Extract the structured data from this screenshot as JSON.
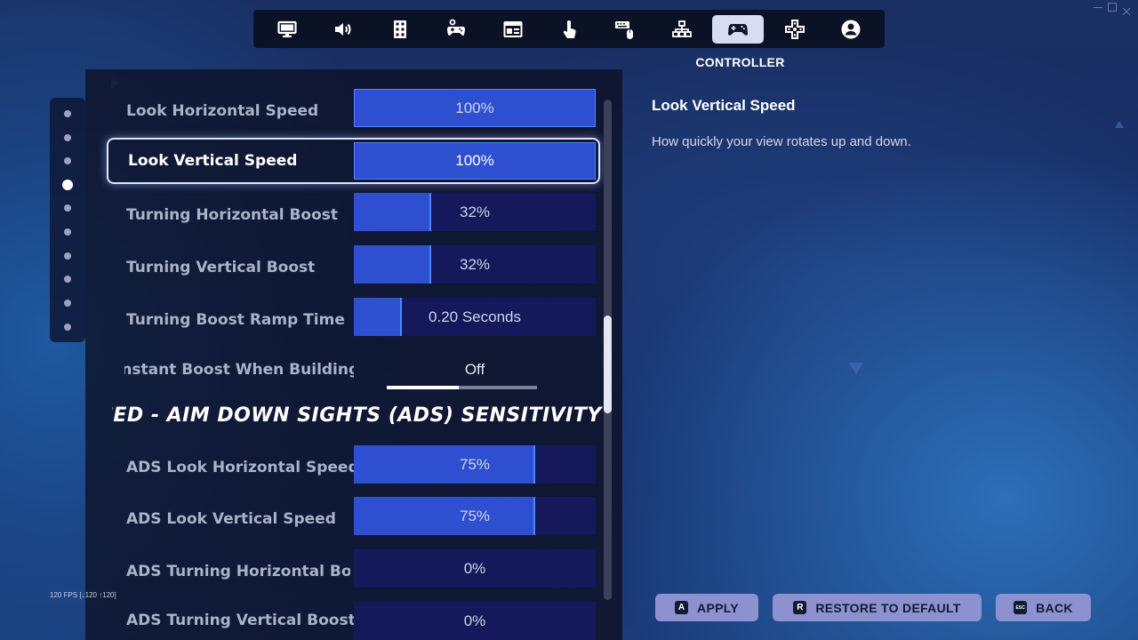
{
  "colors": {
    "accent_fill": "#2e4fd0",
    "slider_track": "#15185a",
    "button_bg": "#8d91cf",
    "selected_border": "#dde4ff"
  },
  "tabs": [
    {
      "icon": "monitor-icon"
    },
    {
      "icon": "speaker-icon"
    },
    {
      "icon": "accessibility-grid-icon"
    },
    {
      "icon": "gamepad-gear-icon"
    },
    {
      "icon": "window-layout-icon"
    },
    {
      "icon": "touch-icon"
    },
    {
      "icon": "keyboard-mouse-icon"
    },
    {
      "icon": "hierarchy-icon"
    },
    {
      "icon": "gamepad-icon",
      "active": true
    },
    {
      "icon": "dpad-icon"
    },
    {
      "icon": "account-icon"
    }
  ],
  "active_tab_title": "CONTROLLER",
  "page_dots": {
    "count": 10,
    "active_index": 3
  },
  "settings": [
    {
      "label": "Look Horizontal Speed",
      "value": "100%",
      "fill": 1.0
    },
    {
      "label": "Look Vertical Speed",
      "value": "100%",
      "fill": 1.0,
      "selected": true
    },
    {
      "label": "Turning Horizontal Boost",
      "value": "32%",
      "fill": 0.32
    },
    {
      "label": "Turning Vertical Boost",
      "value": "32%",
      "fill": 0.32
    },
    {
      "label": "Turning Boost Ramp Time",
      "value": "0.20 Seconds",
      "fill": 0.2
    }
  ],
  "toggle": {
    "label": "Instant Boost When Building",
    "value": "Off"
  },
  "section_header": "ADVANCED - AIM DOWN SIGHTS (ADS) SENSITIVITY",
  "ads_settings": [
    {
      "label": "ADS Look Horizontal Speed",
      "value": "75%",
      "fill": 0.75
    },
    {
      "label": "ADS Look Vertical Speed",
      "value": "75%",
      "fill": 0.75
    },
    {
      "label": "ADS Turning Horizontal Boost",
      "value": "0%",
      "fill": 0
    },
    {
      "label": "ADS Turning Vertical Boost",
      "value": "0%",
      "fill": 0
    }
  ],
  "description": {
    "title": "Look Vertical Speed",
    "text": "How quickly your view rotates up and down."
  },
  "buttons": {
    "apply": {
      "key": "A",
      "label": "APPLY"
    },
    "restore": {
      "key": "R",
      "label": "RESTORE TO DEFAULT"
    },
    "back": {
      "key": "ESC",
      "label": "BACK"
    }
  },
  "fps_counter": "120 FPS [↓120 ↑120]"
}
